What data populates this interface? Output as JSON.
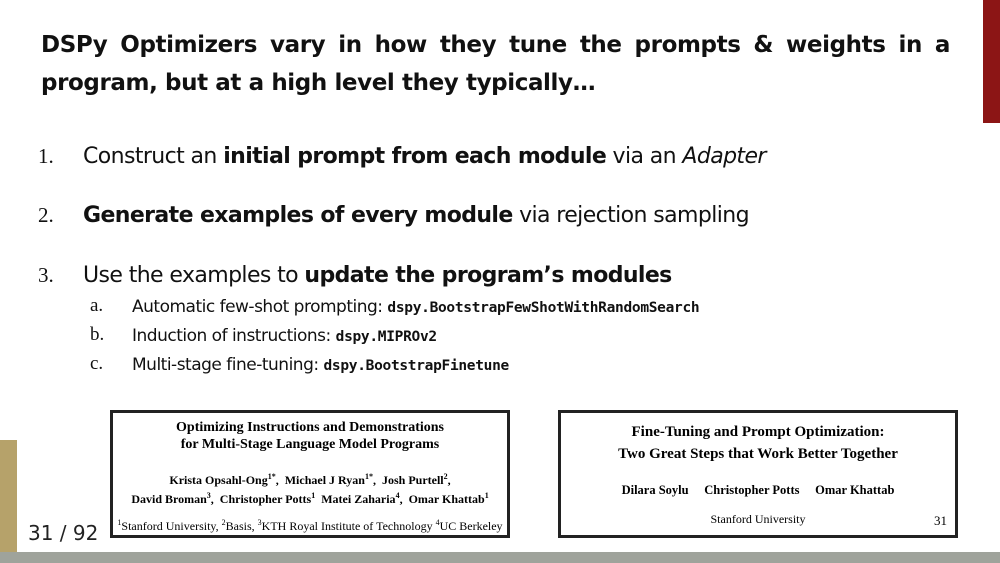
{
  "title": "DSPy Optimizers vary in how they tune the prompts & weights in a program, but at a high level they typically…",
  "items": [
    {
      "num": "1.",
      "pre": "Construct an ",
      "bold": "initial prompt from each module",
      "mid": " via an ",
      "italic": "Adapter"
    },
    {
      "num": "2.",
      "bold": "Generate examples of every module",
      "post": " via rejection sampling"
    },
    {
      "num": "3.",
      "pre": "Use the examples to ",
      "bold": "update the program’s modules"
    }
  ],
  "subitems": [
    {
      "num": "a.",
      "text": "Automatic few-shot prompting: ",
      "code": "dspy.BootstrapFewShotWithRandomSearch"
    },
    {
      "num": "b.",
      "text": "Induction of instructions: ",
      "code": "dspy.MIPROv2"
    },
    {
      "num": "c.",
      "text": "Multi-stage fine-tuning: ",
      "code": "dspy.BootstrapFinetune"
    }
  ],
  "paper1": {
    "title_line1": "Optimizing Instructions and Demonstrations",
    "title_line2": "for Multi-Stage Language Model Programs",
    "authors": {
      "a1": "Krista Opsahl-Ong",
      "a1_sup": "1*",
      "a2": "Michael J Ryan",
      "a2_sup": "1*",
      "a3": "Josh Purtell",
      "a3_sup": "2",
      "a4": "David Broman",
      "a4_sup": "3",
      "a5": "Christopher Potts",
      "a5_sup": "1",
      "a6": "Matei Zaharia",
      "a6_sup": "4",
      "a7": "Omar Khattab",
      "a7_sup": "1"
    },
    "affil": {
      "s1": "1",
      "n1": "Stanford University, ",
      "s2": "2",
      "n2": "Basis, ",
      "s3": "3",
      "n3": "KTH Royal Institute of Technology ",
      "s4": "4",
      "n4": "UC Berkeley"
    }
  },
  "paper2": {
    "title_line1": "Fine-Tuning and Prompt Optimization:",
    "title_line2": "Two Great Steps that Work Better Together",
    "authors": [
      "Dilara Soylu",
      "Christopher Potts",
      "Omar Khattab"
    ],
    "affiliation": "Stanford University",
    "page": "31"
  },
  "page_counter": "31 / 92",
  "colors": {
    "cardinal": "#8c1515",
    "gold": "#b6a26a",
    "footer": "#9fa39b"
  }
}
